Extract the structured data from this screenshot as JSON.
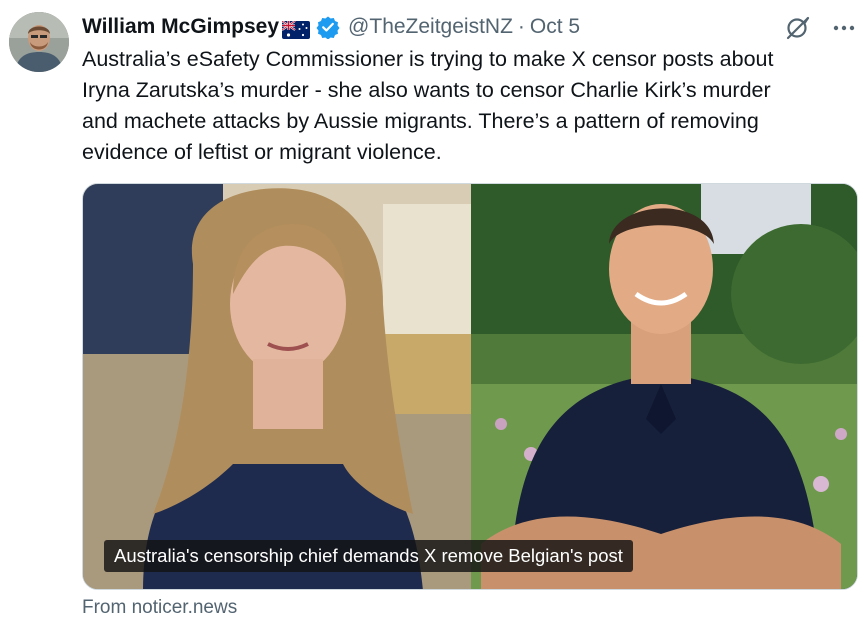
{
  "author": {
    "name": "William McGimpsey",
    "handle": "@TheZeitgeistNZ",
    "separator": "·",
    "date": "Oct 5",
    "flag_icon": "australia-flag-icon",
    "verified_icon": "verified-badge-icon"
  },
  "tweet": {
    "text": "Australia’s eSafety Commissioner is trying to make X censor posts about\nIryna Zarutska’s murder - she also wants to censor Charlie Kirk’s murder\nand machete attacks by Aussie migrants. There’s a pattern of removing\nevidence of leftist or migrant violence."
  },
  "media": {
    "caption": "Australia's censorship chief demands X remove Belgian's post"
  },
  "card": {
    "source": "From noticer.news"
  },
  "icons": {
    "grok": "grok-icon",
    "more": "more-icon"
  },
  "colors": {
    "verified_blue": "#1d9bf0",
    "secondary_text": "#536471",
    "primary_text": "#0f1419"
  }
}
